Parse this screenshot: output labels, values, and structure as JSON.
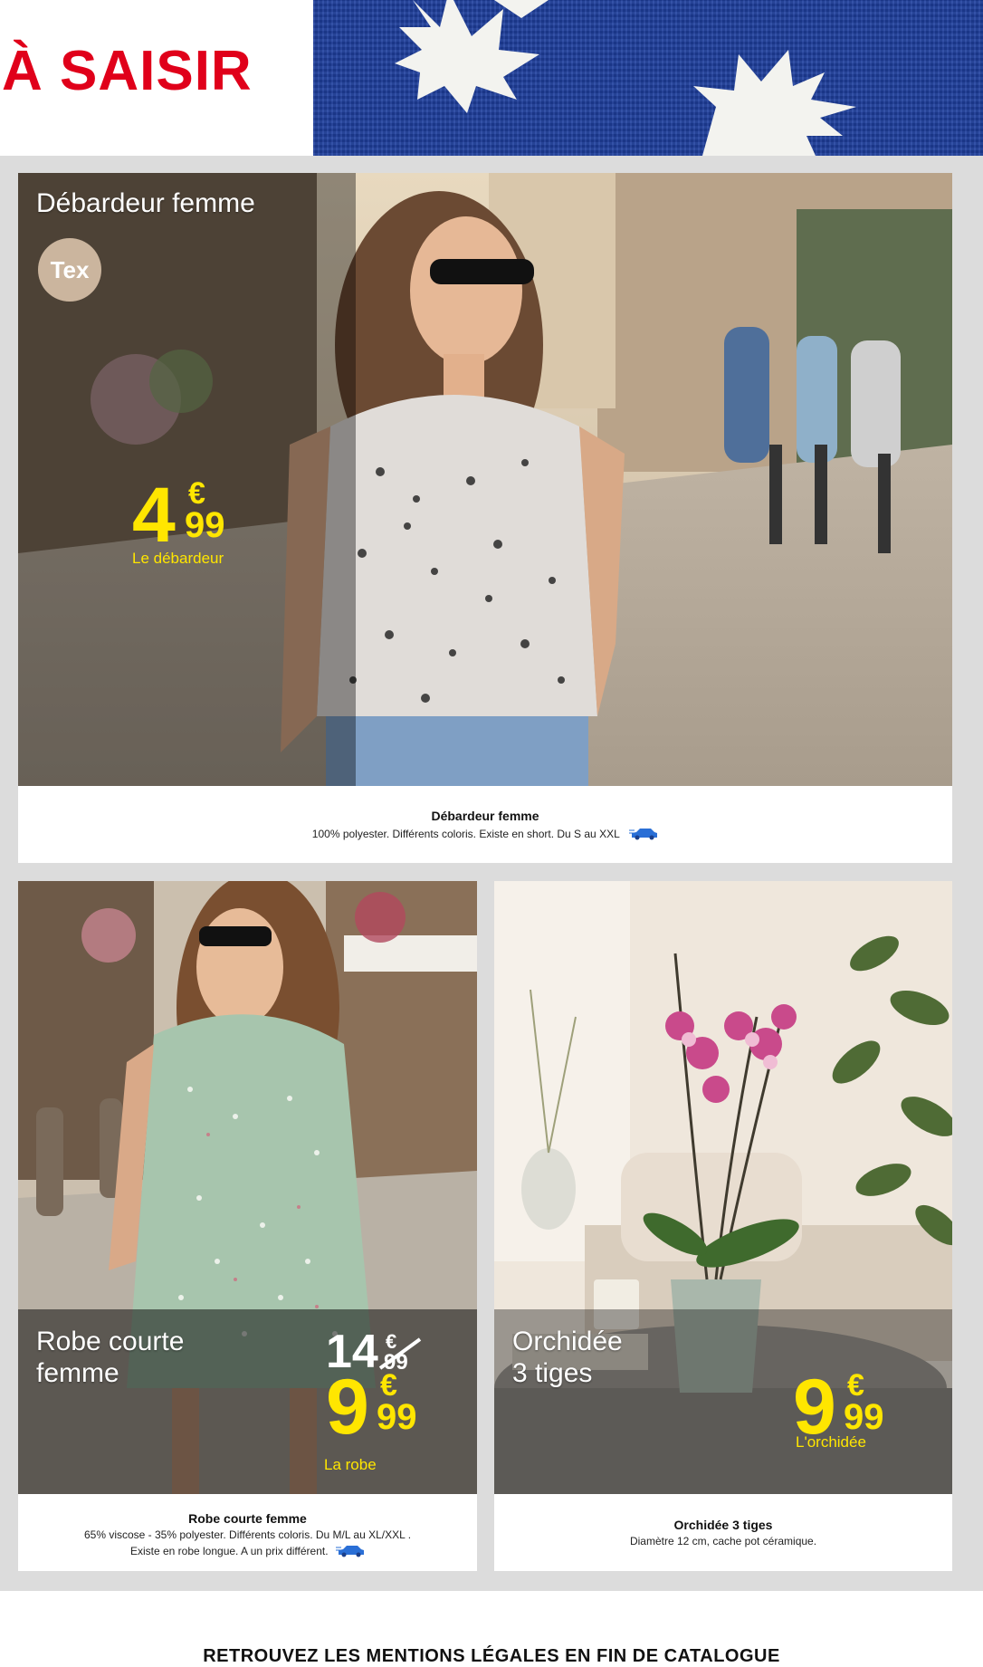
{
  "header": {
    "title": "À SAISIR"
  },
  "products": [
    {
      "name": "Débardeur femme",
      "badge": "Tex",
      "price_int": "4",
      "price_cur": "€",
      "price_dec": "99",
      "unit": "Le débardeur",
      "desc_title": "Débardeur femme",
      "desc_line1": "100% polyester. Différents coloris. Existe en short. Du S au XXL"
    },
    {
      "name_line1": "Robe courte",
      "name_line2": "femme",
      "old_price_int": "14",
      "old_price_cur": "€",
      "old_price_dec": "99",
      "price_int": "9",
      "price_cur": "€",
      "price_dec": "99",
      "unit": "La robe",
      "desc_title": "Robe courte femme",
      "desc_line1": "65% viscose - 35% polyester. Différents coloris. Du M/L au XL/XXL .",
      "desc_line2": "Existe en robe longue. A un prix différent."
    },
    {
      "name_line1": "Orchidée",
      "name_line2": "3 tiges",
      "price_int": "9",
      "price_cur": "€",
      "price_dec": "99",
      "unit": "L'orchidée",
      "desc_title": "Orchidée 3 tiges",
      "desc_line1": "Diamètre 12 cm, cache pot céramique."
    }
  ],
  "footer": {
    "legal": "RETROUVEZ LES MENTIONS LÉGALES EN FIN DE CATALOGUE"
  },
  "colors": {
    "title_red": "#e0001a",
    "price_yellow": "#ffe600",
    "banner_blue": "#1e3f9e",
    "backdrop": "#dcdcdc"
  },
  "icons": [
    "drive-car-icon",
    "starburst-icon"
  ]
}
